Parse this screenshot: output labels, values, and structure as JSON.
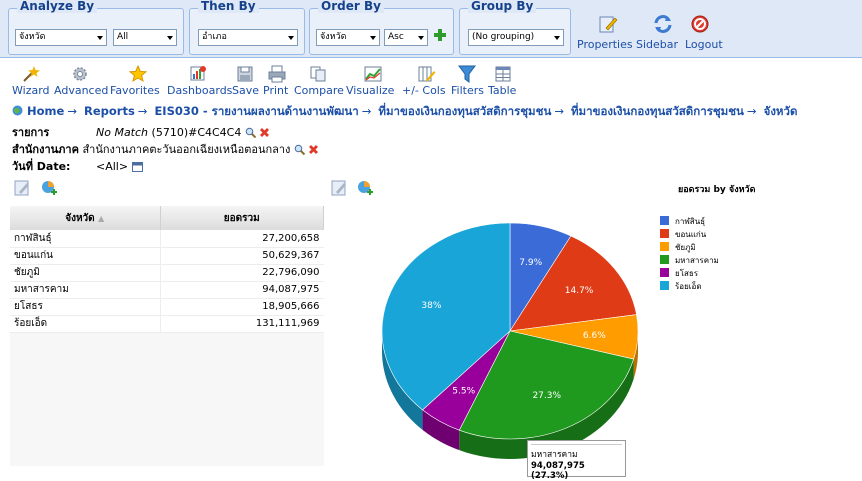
{
  "header": {
    "analyze_by": {
      "label": "Analyze By",
      "select1": "จังหวัด",
      "select2": "All"
    },
    "then_by": {
      "label": "Then By",
      "select": "อำเภอ"
    },
    "order_by": {
      "label": "Order By",
      "select1": "จังหวัด",
      "select2": "Asc"
    },
    "group_by": {
      "label": "Group By",
      "select": "(No grouping)"
    },
    "links": {
      "properties": "Properties",
      "sidebar": "Sidebar",
      "logout": "Logout"
    }
  },
  "toolbar": [
    "Wizard",
    "Advanced",
    "Favorites",
    "Dashboards",
    "Save",
    "Print",
    "Compare",
    "Visualize",
    "+/- Cols",
    "Filters",
    "Table"
  ],
  "breadcrumb": [
    "Home",
    "Reports",
    "EIS030 - รายงานผลงานด้านงานพัฒนา",
    "ที่มาของเงินกองทุนสวัสดิการชุมชน",
    "ที่มาของเงินกองทุนสวัสดิการชุมชน",
    "จังหวัด"
  ],
  "filters": {
    "item_label": "รายการ",
    "item_value_italic": "No Match",
    "item_value": "(5710)#C4C4C4",
    "office_label": "สำนักงานภาค",
    "office_value": "สำนักงานภาคตะวันออกเฉียงเหนือตอนกลาง",
    "date_label": "วันที่ Date:",
    "date_value": "<All>"
  },
  "table": {
    "columns": [
      "จังหวัด",
      "ยอดรวม"
    ],
    "rows": [
      {
        "name": "กาฬสินธุ์",
        "total": "27,200,658"
      },
      {
        "name": "ขอนแก่น",
        "total": "50,629,367"
      },
      {
        "name": "ชัยภูมิ",
        "total": "22,796,090"
      },
      {
        "name": "มหาสารคาม",
        "total": "94,087,975"
      },
      {
        "name": "ยโสธร",
        "total": "18,905,666"
      },
      {
        "name": "ร้อยเอ็ด",
        "total": "131,111,969"
      }
    ]
  },
  "chart_data": {
    "type": "pie",
    "title": "ยอดรวม by จังหวัด",
    "categories": [
      "กาฬสินธุ์",
      "ขอนแก่น",
      "ชัยภูมิ",
      "มหาสารคาม",
      "ยโสธร",
      "ร้อยเอ็ด"
    ],
    "values": [
      27200658,
      50629367,
      22796090,
      94087975,
      18905666,
      131111969
    ],
    "labels": [
      "7.9%",
      "14.7%",
      "6.6%",
      "27.3%",
      "5.5%",
      "38%"
    ],
    "colors": [
      "#3a6bd6",
      "#df3b17",
      "#ff9d00",
      "#1f9a1f",
      "#99009b",
      "#1aa5d9"
    ],
    "legend": "right",
    "tooltip": {
      "name": "มหาสารคาม",
      "value": "94,087,975 (27.3%)"
    }
  }
}
